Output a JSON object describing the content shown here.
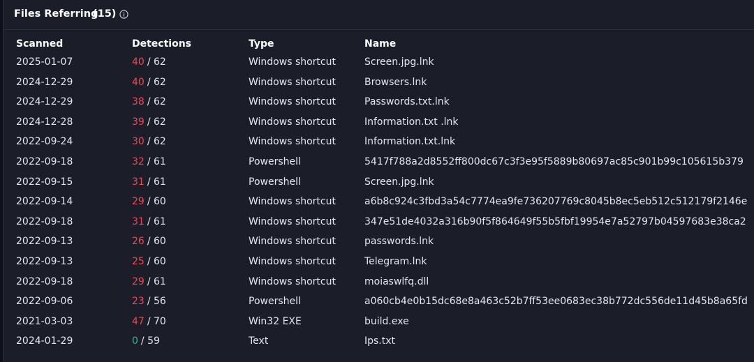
{
  "header": {
    "title": "Files Referring",
    "count": "(15)"
  },
  "columns": {
    "scanned": "Scanned",
    "detections": "Detections",
    "type": "Type",
    "name": "Name"
  },
  "colors": {
    "positive": "#f0484f",
    "clean": "#38b48b"
  },
  "rows": [
    {
      "scanned": "2025-01-07",
      "positives": "40",
      "total": "/ 62",
      "type": "Windows shortcut",
      "name": "Screen.jpg.lnk"
    },
    {
      "scanned": "2024-12-29",
      "positives": "40",
      "total": "/ 62",
      "type": "Windows shortcut",
      "name": "Browsers.lnk"
    },
    {
      "scanned": "2024-12-29",
      "positives": "38",
      "total": "/ 62",
      "type": "Windows shortcut",
      "name": "Passwords.txt.lnk"
    },
    {
      "scanned": "2024-12-28",
      "positives": "39",
      "total": "/ 62",
      "type": "Windows shortcut",
      "name": "Information.txt .lnk"
    },
    {
      "scanned": "2022-09-24",
      "positives": "30",
      "total": "/ 62",
      "type": "Windows shortcut",
      "name": "Information.txt.lnk"
    },
    {
      "scanned": "2022-09-18",
      "positives": "32",
      "total": "/ 61",
      "type": "Powershell",
      "name": "5417f788a2d8552ff800dc67c3f3e95f5889b80697ac85c901b99c105615b379"
    },
    {
      "scanned": "2022-09-15",
      "positives": "31",
      "total": "/ 61",
      "type": "Powershell",
      "name": "Screen.jpg.lnk"
    },
    {
      "scanned": "2022-09-14",
      "positives": "29",
      "total": "/ 60",
      "type": "Windows shortcut",
      "name": "a6b8c924c3fbd3a54c7774ea9fe736207769c8045b8ec5eb512c512179f2146e"
    },
    {
      "scanned": "2022-09-18",
      "positives": "31",
      "total": "/ 61",
      "type": "Windows shortcut",
      "name": "347e51de4032a316b90f5f864649f55b5fbf19954e7a52797b04597683e38ca2"
    },
    {
      "scanned": "2022-09-13",
      "positives": "26",
      "total": "/ 60",
      "type": "Windows shortcut",
      "name": "passwords.lnk"
    },
    {
      "scanned": "2022-09-13",
      "positives": "25",
      "total": "/ 60",
      "type": "Windows shortcut",
      "name": "Telegram.lnk"
    },
    {
      "scanned": "2022-09-18",
      "positives": "29",
      "total": "/ 61",
      "type": "Windows shortcut",
      "name": "moiaswlfq.dll"
    },
    {
      "scanned": "2022-09-06",
      "positives": "23",
      "total": "/ 56",
      "type": "Powershell",
      "name": "a060cb4e0b15dc68e8a463c52b7ff53ee0683ec38b772dc556de11d45b8a65fd"
    },
    {
      "scanned": "2021-03-03",
      "positives": "47",
      "total": "/ 70",
      "type": "Win32 EXE",
      "name": "build.exe"
    },
    {
      "scanned": "2024-01-29",
      "positives": "0",
      "total": "/ 59",
      "type": "Text",
      "name": "Ips.txt"
    }
  ]
}
